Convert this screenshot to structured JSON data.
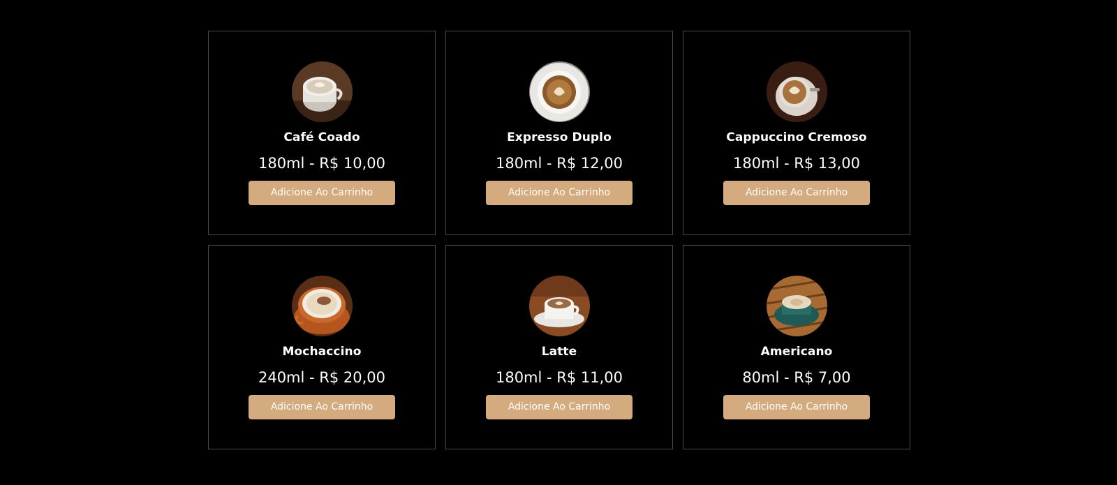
{
  "products": [
    {
      "name": "Café Coado",
      "price": "180ml - R$ 10,00",
      "button_label": "Adicione Ao Carrinho",
      "image_icon": "coffee-cup-icon"
    },
    {
      "name": "Expresso Duplo",
      "price": "180ml - R$ 12,00",
      "button_label": "Adicione Ao Carrinho",
      "image_icon": "coffee-cup-icon"
    },
    {
      "name": "Cappuccino Cremoso",
      "price": "180ml - R$ 13,00",
      "button_label": "Adicione Ao Carrinho",
      "image_icon": "coffee-cup-icon"
    },
    {
      "name": "Mochaccino",
      "price": "240ml - R$ 20,00",
      "button_label": "Adicione Ao Carrinho",
      "image_icon": "coffee-cup-icon"
    },
    {
      "name": "Latte",
      "price": "180ml - R$ 11,00",
      "button_label": "Adicione Ao Carrinho",
      "image_icon": "coffee-cup-icon"
    },
    {
      "name": "Americano",
      "price": "80ml - R$ 7,00",
      "button_label": "Adicione Ao Carrinho",
      "image_icon": "coffee-cup-icon"
    }
  ],
  "colors": {
    "background": "#000000",
    "card_border": "#4a4a4a",
    "button": "#d4ab7e",
    "text": "#ffffff"
  }
}
